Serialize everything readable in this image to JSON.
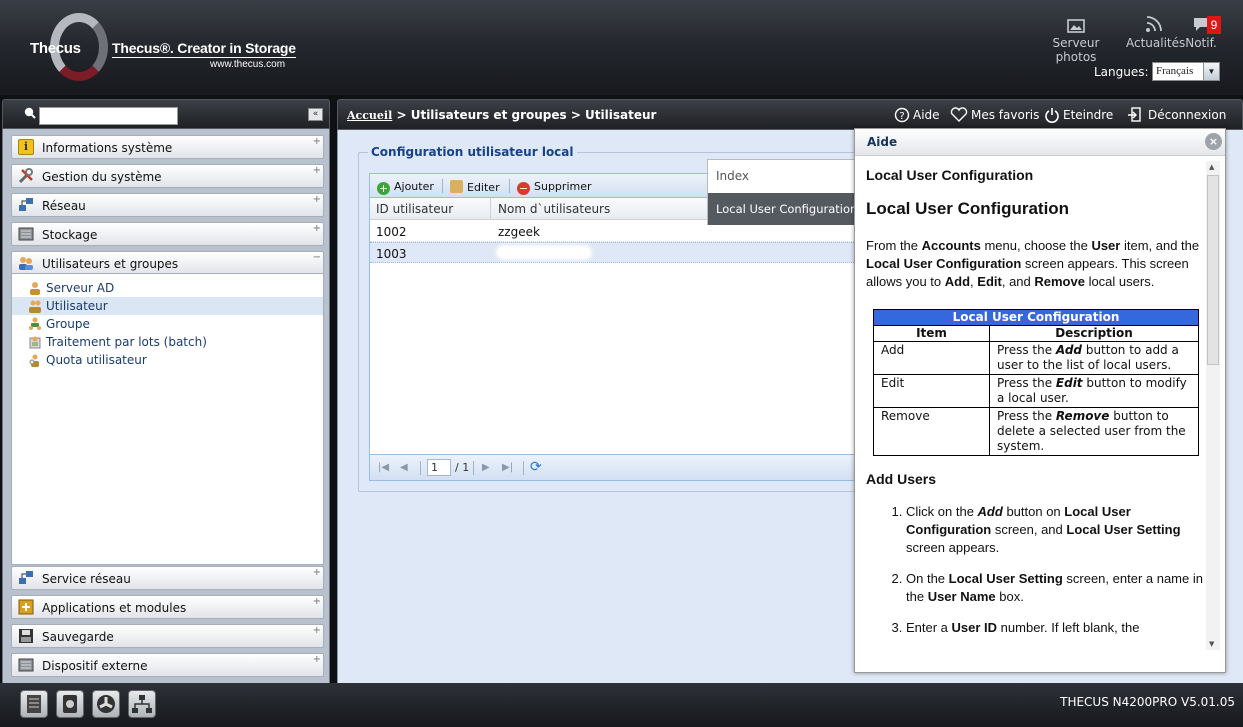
{
  "header": {
    "brand": "Thecus",
    "slogan": "Thecus®. Creator in Storage",
    "url": "www.thecus.com",
    "photo_server": "Serveur photos",
    "news": "Actualités",
    "notif": "Notif.",
    "notif_count": "9",
    "language_label": "Langues:",
    "language_value": "Français"
  },
  "breadcrumb": "Accueil > Utilisateurs et groupes > Utilisateur",
  "breadcrumb_home": "Accueil",
  "breadcrumb_rest": " > Utilisateurs et groupes > Utilisateur",
  "toolbar": {
    "help": "Aide",
    "favorites": "Mes favoris",
    "shutdown": "Eteindre",
    "logout": "Déconnexion"
  },
  "sidebar": {
    "categories": [
      "Informations système",
      "Gestion du système",
      "Réseau",
      "Stockage",
      "Utilisateurs et groupes",
      "Service réseau",
      "Applications et modules",
      "Sauvegarde",
      "Dispositif externe"
    ],
    "sub_items": [
      "Serveur AD",
      "Utilisateur",
      "Groupe",
      "Traitement par lots (batch)",
      "Quota utilisateur"
    ]
  },
  "panel": {
    "title": "Configuration utilisateur local",
    "add": "Ajouter",
    "edit": "Editer",
    "delete": "Supprimer",
    "columns": [
      "ID utilisateur",
      "Nom d`utilisateurs"
    ],
    "rows": [
      {
        "id": "1002",
        "name": "zzgeek"
      },
      {
        "id": "1003",
        "name": ""
      }
    ],
    "page_current": "1",
    "page_total": "/ 1"
  },
  "index_popup": {
    "title": "Index",
    "item": "Local User Configuration"
  },
  "help": {
    "title": "Aide",
    "heading_small": "Local User Configuration",
    "heading_large": "Local User Configuration",
    "intro": {
      "t1": "From the ",
      "b1": "Accounts",
      "t2": " menu, choose the ",
      "b2": "User",
      "t3": " item, and the ",
      "b3": "Local User Configuration",
      "t4": " screen appears. This screen allows you to ",
      "b4": "Add",
      "t5": ", ",
      "b5": "Edit",
      "t6": ", and ",
      "b6": "Remove",
      "t7": " local users."
    },
    "table": {
      "caption": "Local User Configuration",
      "col_item": "Item",
      "col_desc": "Description",
      "rows": [
        {
          "item": "Add",
          "pre": "Press the ",
          "key": "Add",
          "post": " button to add a user to the list of local users."
        },
        {
          "item": "Edit",
          "pre": "Press the ",
          "key": "Edit",
          "post": " button to modify a local user."
        },
        {
          "item": "Remove",
          "pre": "Press the ",
          "key": "Remove",
          "post": " button to delete a selected user from the system."
        }
      ]
    },
    "add_users_heading": "Add Users",
    "steps": [
      {
        "t1": "Click on the ",
        "bi": "Add",
        "t2": " button on ",
        "b1": "Local User Configuration",
        "t3": " screen, and ",
        "b2": "Local User Setting",
        "t4": " screen appears."
      },
      {
        "t1": "On the ",
        "b1": "Local User Setting",
        "t2": " screen, enter a name in the ",
        "b2": "User Name",
        "t3": " box."
      },
      {
        "t1": "Enter a ",
        "b1": "User ID",
        "t2": " number. If left blank, the"
      }
    ]
  },
  "footer": {
    "version": "THECUS N4200PRO V5.01.05"
  },
  "colors": {
    "header_dark": "#25282e",
    "accent_blue": "#3468dc",
    "notif_red": "#e01515",
    "panel_bg": "#dfe8f6"
  }
}
